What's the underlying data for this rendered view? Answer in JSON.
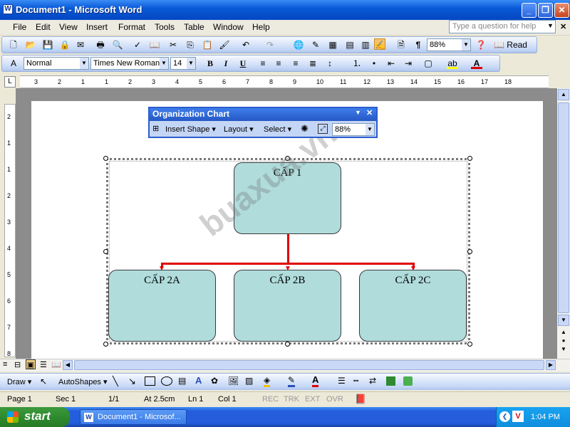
{
  "window": {
    "title": "Document1 - Microsoft Word"
  },
  "menu": [
    "File",
    "Edit",
    "View",
    "Insert",
    "Format",
    "Tools",
    "Table",
    "Window",
    "Help"
  ],
  "ask_placeholder": "Type a question for help",
  "standard_toolbar": {
    "zoom": "88%",
    "read_label": "Read"
  },
  "format_toolbar": {
    "style": "Normal",
    "font": "Times New Roman",
    "size": "14",
    "bold": "B",
    "italic": "I",
    "underline": "U"
  },
  "ruler": {
    "ticks": [
      "3",
      "2",
      "1",
      "1",
      "2",
      "3",
      "4",
      "5",
      "6",
      "7",
      "8",
      "9",
      "10",
      "11",
      "12",
      "13",
      "14",
      "15",
      "16",
      "17",
      "18"
    ],
    "vticks": [
      "2",
      "1",
      "1",
      "2",
      "3",
      "4",
      "5",
      "6",
      "7",
      "8"
    ]
  },
  "org_toolbar": {
    "title": "Organization Chart",
    "insert_shape": "Insert Shape",
    "layout": "Layout",
    "select": "Select",
    "zoom": "88%"
  },
  "org_chart": {
    "top": "CẤP 1",
    "children": [
      "CẤP 2A",
      "CẤP 2B",
      "CẤP 2C"
    ],
    "box_color": "#B0DCDC",
    "connector_color": "#E00000"
  },
  "watermark": "buaxua.vn",
  "draw_toolbar": {
    "draw": "Draw",
    "autoshapes": "AutoShapes"
  },
  "status": {
    "page": "Page  1",
    "sec": "Sec  1",
    "pages": "1/1",
    "at": "At  2.5cm",
    "ln": "Ln  1",
    "col": "Col  1",
    "rec": "REC",
    "trk": "TRK",
    "ext": "EXT",
    "ovr": "OVR"
  },
  "taskbar": {
    "start": "start",
    "item": "Document1 - Microsof...",
    "time": "1:04 PM"
  }
}
